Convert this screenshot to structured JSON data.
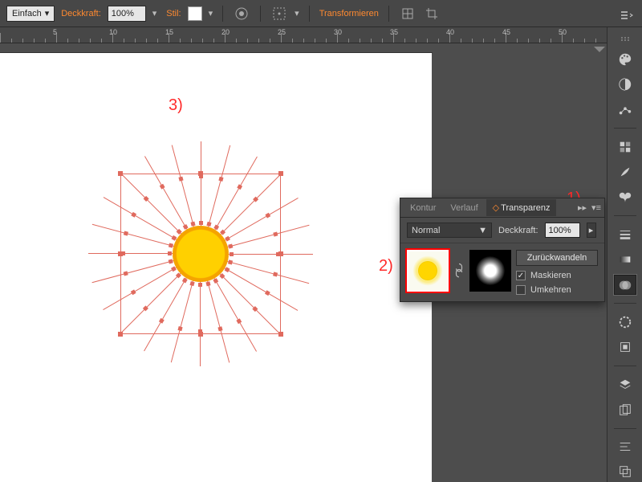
{
  "toolbar": {
    "mode": "Einfach",
    "opacity_label": "Deckkraft:",
    "opacity_value": "100%",
    "style_label": "Stil:",
    "transform_label": "Transformieren"
  },
  "ruler": {
    "marks": [
      5,
      10,
      15,
      20,
      25,
      30,
      35,
      40,
      45,
      50
    ]
  },
  "annotations": {
    "one": "1)",
    "two": "2)",
    "three": "3)"
  },
  "panel": {
    "tabs": {
      "kontur": "Kontur",
      "verlauf": "Verlauf",
      "transparenz": "Transparenz",
      "prefix": "◇"
    },
    "blend_mode": "Normal",
    "opacity_label": "Deckkraft:",
    "opacity_value": "100%",
    "revert_btn": "Zurückwandeln",
    "mask_clip": "Maskieren",
    "mask_invert": "Umkehren",
    "mask_clip_checked": true,
    "mask_invert_checked": false
  },
  "tools": [
    "color-palette-icon",
    "color-guide-icon",
    "graph-icon",
    "swatches-icon",
    "brushes-icon",
    "symbols-icon",
    "stroke-icon",
    "gradient-icon",
    "transparency-icon",
    "appearance-icon",
    "graphic-styles-icon",
    "layers-icon",
    "artboards-icon",
    "align-icon",
    "pathfinder-icon"
  ],
  "selected_tool_index": 8
}
